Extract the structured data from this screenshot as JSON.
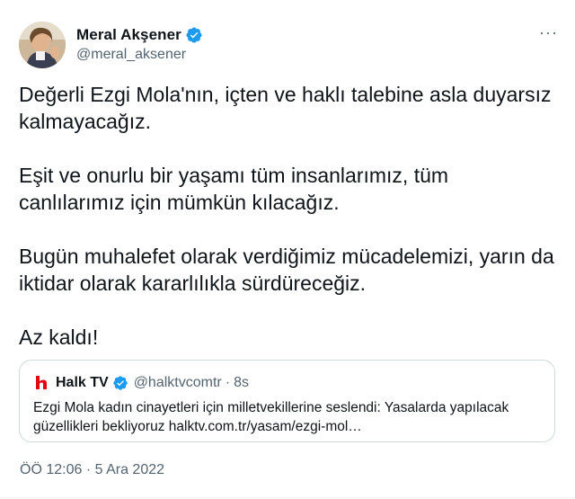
{
  "author": {
    "display_name": "Meral Akşener",
    "handle": "@meral_aksener",
    "verified": true
  },
  "tweet": {
    "paragraphs": [
      "Değerli Ezgi Mola'nın, içten ve haklı talebine asla duyarsız kalmayacağız.",
      "Eşit ve onurlu bir yaşamı tüm insanlarımız, tüm canlılarımız için mümkün kılacağız.",
      "Bugün muhalefet olarak verdiğimiz mücadelemizi, yarın da iktidar olarak kararlılıkla sürdüreceğiz.",
      "Az kaldı!"
    ],
    "time": "ÖÖ 12:06",
    "separator": "·",
    "date": "5 Ara 2022"
  },
  "quote": {
    "logo_icon": "halktv-logo-icon",
    "display_name": "Halk TV",
    "handle": "@halktvcomtr",
    "separator": "·",
    "time": "8s",
    "verified": true,
    "text": "Ezgi Mola kadın cinayetleri için milletvekillerine seslendi: Yasalarda yapılacak güzellikleri bekliyoruz halktv.com.tr/yasam/ezgi-mol…"
  },
  "menu": {
    "more_label": "···"
  },
  "colors": {
    "verified": "#1d9bf0",
    "text": "#0f1419",
    "muted": "#536471",
    "border": "#cfd9de",
    "halktv_red": "#e30613"
  }
}
